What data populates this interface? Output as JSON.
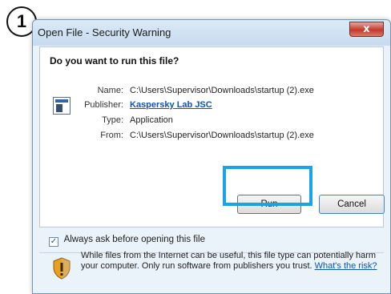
{
  "step": {
    "number": "1"
  },
  "window": {
    "title": "Open File - Security Warning",
    "close_label": "x"
  },
  "dialog": {
    "question": "Do you want to run this file?",
    "fields": [
      {
        "label": "Name:",
        "value": "C:\\Users\\Supervisor\\Downloads\\startup (2).exe"
      },
      {
        "label": "Publisher:",
        "value": "Kaspersky Lab JSC"
      },
      {
        "label": "Type:",
        "value": "Application"
      },
      {
        "label": "From:",
        "value": "C:\\Users\\Supervisor\\Downloads\\startup (2).exe"
      }
    ],
    "run_label": "Run",
    "cancel_label": "Cancel",
    "checkbox_label": "Always ask before opening this file",
    "checkbox_checked": true,
    "warning_text": "While files from the Internet can be useful, this file type can potentially harm your computer. Only run software from publishers you trust.",
    "risk_link": "What's the risk?"
  },
  "colors": {
    "highlight": "#1aa3e8",
    "link": "#0b55b8",
    "close": "#c3392b"
  },
  "icons": {
    "file": "application-file-icon",
    "shield": "security-shield-icon"
  }
}
